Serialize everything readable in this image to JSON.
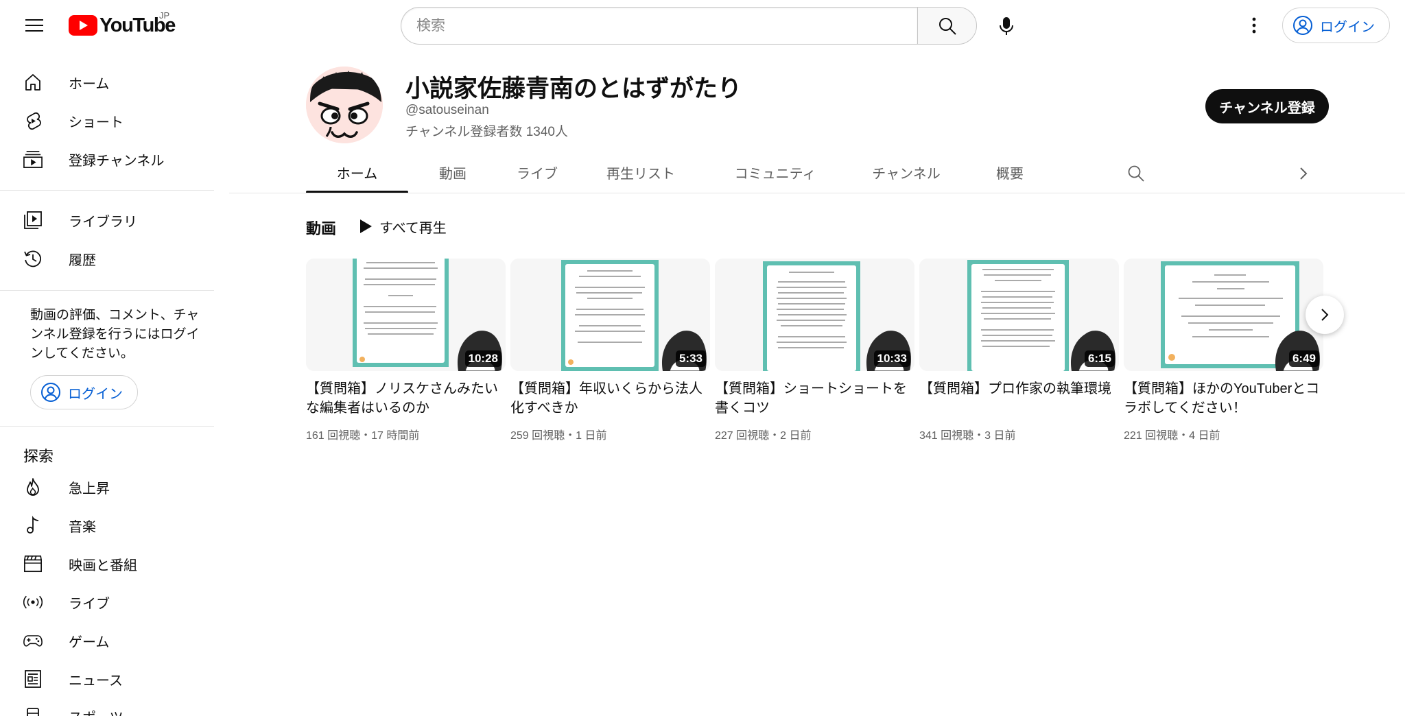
{
  "header": {
    "logo_text": "YouTube",
    "country_code": "JP",
    "search_placeholder": "検索",
    "login_label": "ログイン"
  },
  "sidebar": {
    "primary": [
      {
        "label": "ホーム",
        "icon": "home-icon"
      },
      {
        "label": "ショート",
        "icon": "shorts-icon"
      },
      {
        "label": "登録チャンネル",
        "icon": "subscriptions-icon"
      }
    ],
    "library": [
      {
        "label": "ライブラリ",
        "icon": "library-icon"
      },
      {
        "label": "履歴",
        "icon": "history-icon"
      }
    ],
    "login_note": "動画の評価、コメント、チャンネル登録を行うにはログインしてください。",
    "login_label": "ログイン",
    "explore_title": "探索",
    "explore": [
      {
        "label": "急上昇",
        "icon": "trending-icon"
      },
      {
        "label": "音楽",
        "icon": "music-icon"
      },
      {
        "label": "映画と番組",
        "icon": "movies-icon"
      },
      {
        "label": "ライブ",
        "icon": "live-icon"
      },
      {
        "label": "ゲーム",
        "icon": "gaming-icon"
      },
      {
        "label": "ニュース",
        "icon": "news-icon"
      },
      {
        "label": "スポーツ",
        "icon": "sports-icon"
      }
    ]
  },
  "channel": {
    "title": "小説家佐藤青南のとはずがたり",
    "handle": "@satouseinan",
    "subscribers": "チャンネル登録者数 1340人",
    "subscribe_label": "チャンネル登録"
  },
  "tabs": [
    {
      "label": "ホーム",
      "active": true
    },
    {
      "label": "動画",
      "active": false
    },
    {
      "label": "ライブ",
      "active": false
    },
    {
      "label": "再生リスト",
      "active": false
    },
    {
      "label": "コミュニティ",
      "active": false
    },
    {
      "label": "チャンネル",
      "active": false
    },
    {
      "label": "概要",
      "active": false
    }
  ],
  "shelf": {
    "title": "動画",
    "play_all_label": "すべて再生",
    "videos": [
      {
        "title": "【質問箱】ノリスケさんみたいな編集者はいるのか",
        "duration": "10:28",
        "meta": "161 回視聴・17 時間前"
      },
      {
        "title": "【質問箱】年収いくらから法人化すべきか",
        "duration": "5:33",
        "meta": "259 回視聴・1 日前"
      },
      {
        "title": "【質問箱】ショートショートを書くコツ",
        "duration": "10:33",
        "meta": "227 回視聴・2 日前"
      },
      {
        "title": "【質問箱】プロ作家の執筆環境",
        "duration": "6:15",
        "meta": "341 回視聴・3 日前"
      },
      {
        "title": "【質問箱】ほかのYouTuberとコラボしてください！",
        "duration": "6:49",
        "meta": "221 回視聴・4 日前"
      }
    ]
  },
  "colors": {
    "youtube_red": "#ff0000",
    "link_blue": "#065fd4",
    "thumb_teal": "#5fbfb1"
  }
}
